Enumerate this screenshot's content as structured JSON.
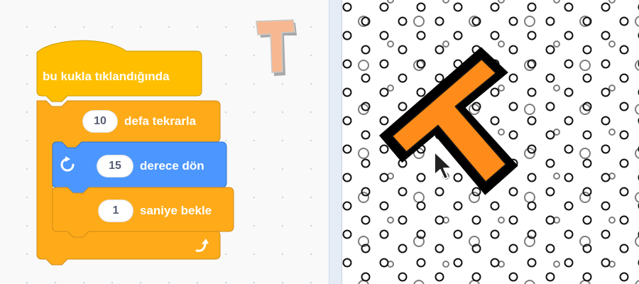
{
  "code_area": {
    "hat_block": {
      "label": "bu kukla tıklandığında"
    },
    "repeat_block": {
      "count": "10",
      "label": "defa tekrarla"
    },
    "turn_block": {
      "degrees": "15",
      "label": "derece dön",
      "icon": "rotate-right-icon"
    },
    "wait_block": {
      "seconds": "1",
      "label": "saniye bekle"
    },
    "loop_arrow": {
      "icon": "loop-arrow-icon"
    },
    "sprite_thumbnail": {
      "letter": "T",
      "icon": "letter-t-sprite-icon"
    }
  },
  "stage": {
    "sprite": {
      "letter": "T",
      "icon": "letter-t-sprite-icon"
    },
    "cursor": {
      "icon": "mouse-pointer-icon"
    },
    "backdrop": {
      "pattern": "polka-dot-circles"
    }
  },
  "colors": {
    "events_block": "#ffbf00",
    "control_block": "#ffab19",
    "motion_block": "#4c97ff",
    "sprite_fill": "#ff8c1a",
    "sprite_outline": "#000000",
    "input_text": "#575e75"
  }
}
